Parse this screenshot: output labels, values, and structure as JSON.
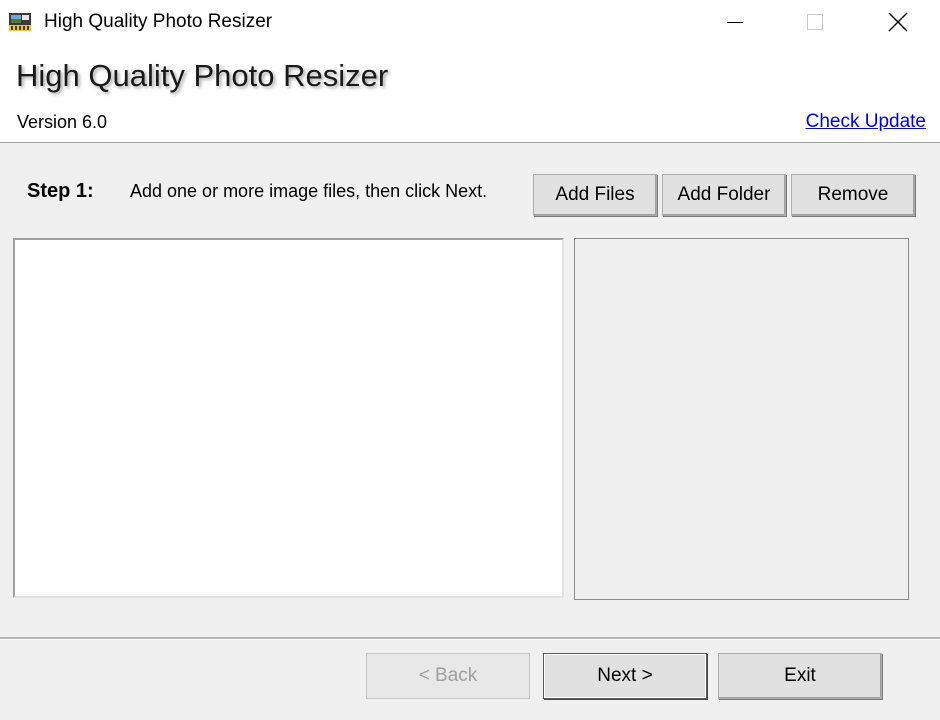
{
  "window": {
    "title": "High Quality Photo Resizer",
    "icon": "photo-resizer-app-icon"
  },
  "header": {
    "app_title": "High Quality Photo Resizer",
    "version": "Version 6.0",
    "check_update": "Check Update"
  },
  "step": {
    "label": "Step 1:",
    "description": "Add one or more image files, then click Next."
  },
  "toolbar": {
    "add_files": "Add Files",
    "add_folder": "Add Folder",
    "remove": "Remove"
  },
  "file_list": {
    "items": []
  },
  "nav": {
    "back": "< Back",
    "next": "Next >",
    "exit": "Exit"
  },
  "colors": {
    "background": "#f0f0f0",
    "link": "#0000ee",
    "disabled_text": "#a0a0a0"
  }
}
